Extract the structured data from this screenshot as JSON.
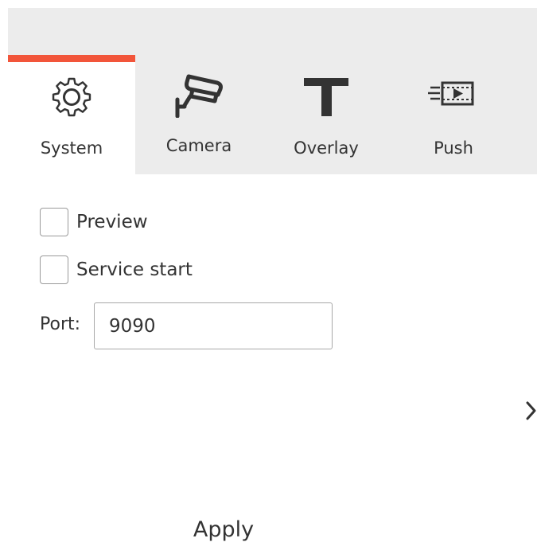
{
  "tabs": [
    {
      "label": "System",
      "icon": "gear-icon",
      "active": true
    },
    {
      "label": "Camera",
      "icon": "cctv-camera-icon",
      "active": false
    },
    {
      "label": "Overlay",
      "icon": "text-t-icon",
      "active": false
    },
    {
      "label": "Push",
      "icon": "video-push-icon",
      "active": false
    }
  ],
  "options": {
    "preview": {
      "label": "Preview",
      "checked": false
    },
    "service_start": {
      "label": "Service start",
      "checked": false
    }
  },
  "port": {
    "label": "Port:",
    "value": "9090"
  },
  "apply_label": "Apply",
  "colors": {
    "accent": "#f2553a",
    "tab_bar_bg": "#ececec",
    "text": "#333333"
  }
}
